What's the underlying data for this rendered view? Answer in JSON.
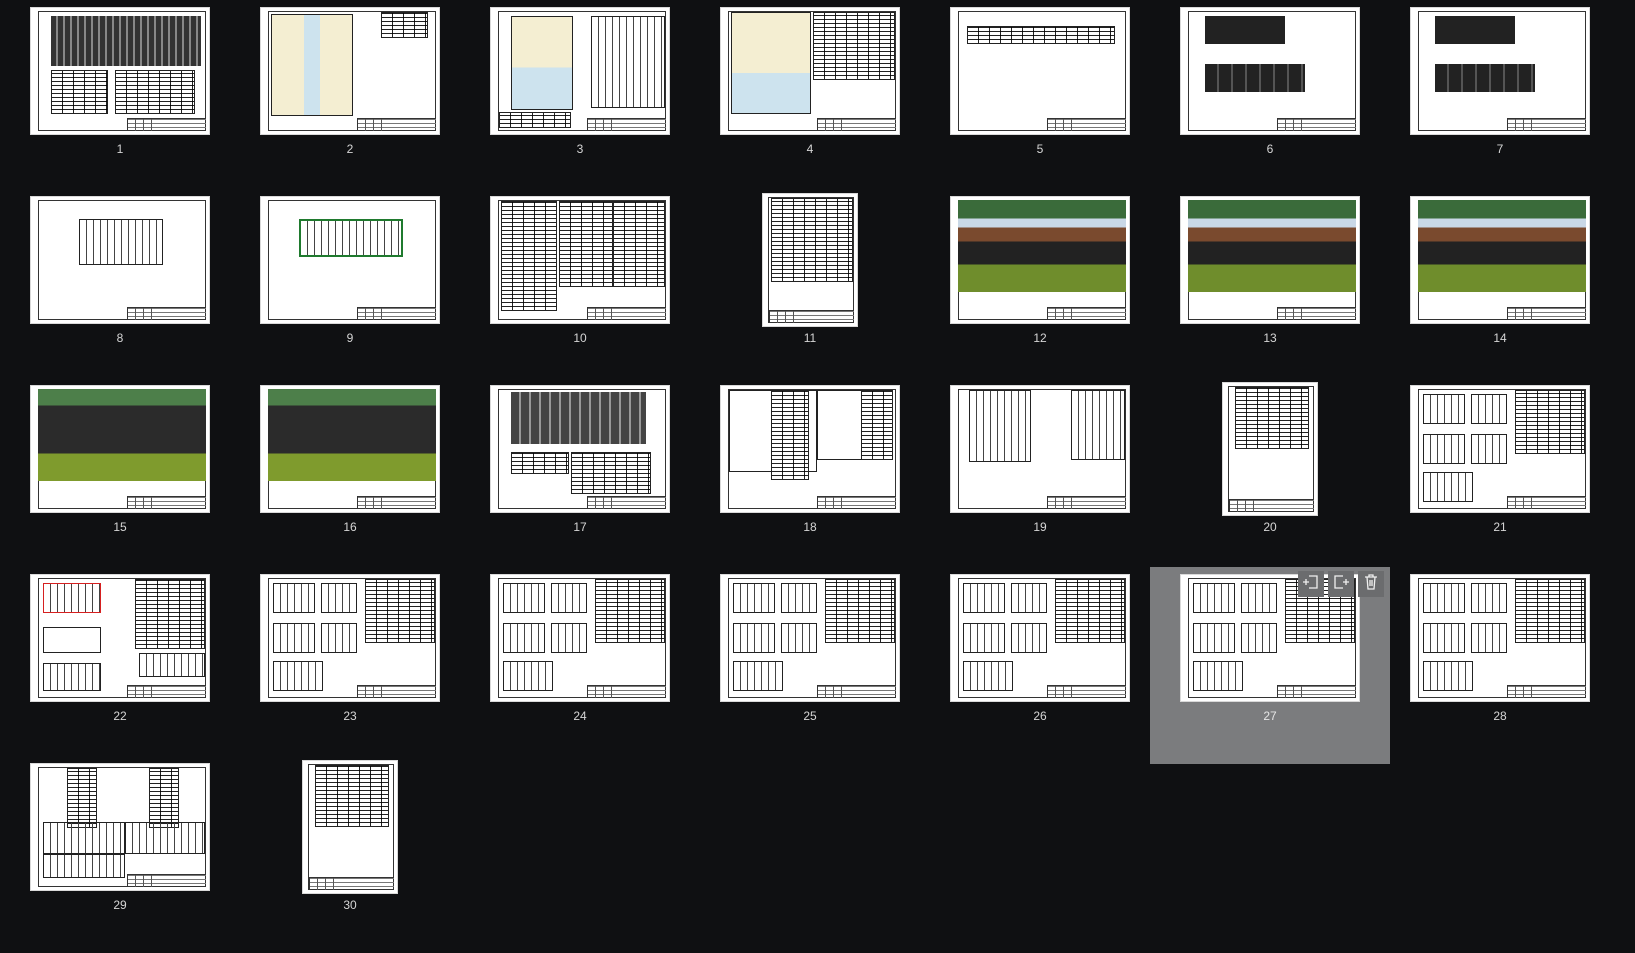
{
  "pages": [
    {
      "label": "1",
      "orientation": "land",
      "kind": "facade-tables"
    },
    {
      "label": "2",
      "orientation": "land",
      "kind": "plan"
    },
    {
      "label": "3",
      "orientation": "land",
      "kind": "plan-dims"
    },
    {
      "label": "4",
      "orientation": "land",
      "kind": "plan-table"
    },
    {
      "label": "5",
      "orientation": "land",
      "kind": "strip"
    },
    {
      "label": "6",
      "orientation": "land",
      "kind": "elevations"
    },
    {
      "label": "7",
      "orientation": "land",
      "kind": "elevations"
    },
    {
      "label": "8",
      "orientation": "land",
      "kind": "section"
    },
    {
      "label": "9",
      "orientation": "land",
      "kind": "section-green"
    },
    {
      "label": "10",
      "orientation": "land",
      "kind": "tables3"
    },
    {
      "label": "11",
      "orientation": "port",
      "kind": "table-tall"
    },
    {
      "label": "12",
      "orientation": "land",
      "kind": "render-warm"
    },
    {
      "label": "13",
      "orientation": "land",
      "kind": "render-warm"
    },
    {
      "label": "14",
      "orientation": "land",
      "kind": "render-warm"
    },
    {
      "label": "15",
      "orientation": "land",
      "kind": "render-dark"
    },
    {
      "label": "16",
      "orientation": "land",
      "kind": "render-dark"
    },
    {
      "label": "17",
      "orientation": "land",
      "kind": "frame-tables"
    },
    {
      "label": "18",
      "orientation": "land",
      "kind": "boxes-tables"
    },
    {
      "label": "19",
      "orientation": "land",
      "kind": "framing-plans"
    },
    {
      "label": "20",
      "orientation": "port",
      "kind": "table-top"
    },
    {
      "label": "21",
      "orientation": "land",
      "kind": "panels-table"
    },
    {
      "label": "22",
      "orientation": "land",
      "kind": "panels-table-red"
    },
    {
      "label": "23",
      "orientation": "land",
      "kind": "panels-table"
    },
    {
      "label": "24",
      "orientation": "land",
      "kind": "panels-table"
    },
    {
      "label": "25",
      "orientation": "land",
      "kind": "panels-table"
    },
    {
      "label": "26",
      "orientation": "land",
      "kind": "panels-table"
    },
    {
      "label": "27",
      "orientation": "land",
      "kind": "panels-table",
      "selected": true
    },
    {
      "label": "28",
      "orientation": "land",
      "kind": "panels-table"
    },
    {
      "label": "29",
      "orientation": "land",
      "kind": "tall-tables"
    },
    {
      "label": "30",
      "orientation": "port",
      "kind": "table-top"
    }
  ],
  "toolbar": {
    "buttons": [
      {
        "name": "insert-before-icon"
      },
      {
        "name": "insert-after-icon"
      },
      {
        "name": "delete-icon"
      }
    ]
  },
  "colors": {
    "background": "#0f1012",
    "selection": "#7b7c7e",
    "label": "#d6d6d6"
  }
}
